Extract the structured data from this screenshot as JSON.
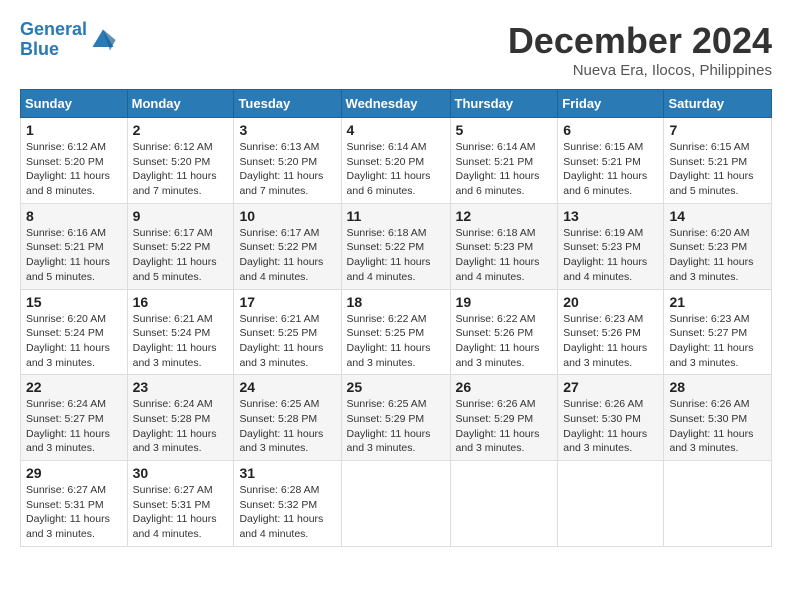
{
  "logo": {
    "line1": "General",
    "line2": "Blue"
  },
  "title": "December 2024",
  "location": "Nueva Era, Ilocos, Philippines",
  "weekdays": [
    "Sunday",
    "Monday",
    "Tuesday",
    "Wednesday",
    "Thursday",
    "Friday",
    "Saturday"
  ],
  "weeks": [
    [
      {
        "day": "1",
        "sunrise": "6:12 AM",
        "sunset": "5:20 PM",
        "daylight": "11 hours and 8 minutes."
      },
      {
        "day": "2",
        "sunrise": "6:12 AM",
        "sunset": "5:20 PM",
        "daylight": "11 hours and 7 minutes."
      },
      {
        "day": "3",
        "sunrise": "6:13 AM",
        "sunset": "5:20 PM",
        "daylight": "11 hours and 7 minutes."
      },
      {
        "day": "4",
        "sunrise": "6:14 AM",
        "sunset": "5:20 PM",
        "daylight": "11 hours and 6 minutes."
      },
      {
        "day": "5",
        "sunrise": "6:14 AM",
        "sunset": "5:21 PM",
        "daylight": "11 hours and 6 minutes."
      },
      {
        "day": "6",
        "sunrise": "6:15 AM",
        "sunset": "5:21 PM",
        "daylight": "11 hours and 6 minutes."
      },
      {
        "day": "7",
        "sunrise": "6:15 AM",
        "sunset": "5:21 PM",
        "daylight": "11 hours and 5 minutes."
      }
    ],
    [
      {
        "day": "8",
        "sunrise": "6:16 AM",
        "sunset": "5:21 PM",
        "daylight": "11 hours and 5 minutes."
      },
      {
        "day": "9",
        "sunrise": "6:17 AM",
        "sunset": "5:22 PM",
        "daylight": "11 hours and 5 minutes."
      },
      {
        "day": "10",
        "sunrise": "6:17 AM",
        "sunset": "5:22 PM",
        "daylight": "11 hours and 4 minutes."
      },
      {
        "day": "11",
        "sunrise": "6:18 AM",
        "sunset": "5:22 PM",
        "daylight": "11 hours and 4 minutes."
      },
      {
        "day": "12",
        "sunrise": "6:18 AM",
        "sunset": "5:23 PM",
        "daylight": "11 hours and 4 minutes."
      },
      {
        "day": "13",
        "sunrise": "6:19 AM",
        "sunset": "5:23 PM",
        "daylight": "11 hours and 4 minutes."
      },
      {
        "day": "14",
        "sunrise": "6:20 AM",
        "sunset": "5:23 PM",
        "daylight": "11 hours and 3 minutes."
      }
    ],
    [
      {
        "day": "15",
        "sunrise": "6:20 AM",
        "sunset": "5:24 PM",
        "daylight": "11 hours and 3 minutes."
      },
      {
        "day": "16",
        "sunrise": "6:21 AM",
        "sunset": "5:24 PM",
        "daylight": "11 hours and 3 minutes."
      },
      {
        "day": "17",
        "sunrise": "6:21 AM",
        "sunset": "5:25 PM",
        "daylight": "11 hours and 3 minutes."
      },
      {
        "day": "18",
        "sunrise": "6:22 AM",
        "sunset": "5:25 PM",
        "daylight": "11 hours and 3 minutes."
      },
      {
        "day": "19",
        "sunrise": "6:22 AM",
        "sunset": "5:26 PM",
        "daylight": "11 hours and 3 minutes."
      },
      {
        "day": "20",
        "sunrise": "6:23 AM",
        "sunset": "5:26 PM",
        "daylight": "11 hours and 3 minutes."
      },
      {
        "day": "21",
        "sunrise": "6:23 AM",
        "sunset": "5:27 PM",
        "daylight": "11 hours and 3 minutes."
      }
    ],
    [
      {
        "day": "22",
        "sunrise": "6:24 AM",
        "sunset": "5:27 PM",
        "daylight": "11 hours and 3 minutes."
      },
      {
        "day": "23",
        "sunrise": "6:24 AM",
        "sunset": "5:28 PM",
        "daylight": "11 hours and 3 minutes."
      },
      {
        "day": "24",
        "sunrise": "6:25 AM",
        "sunset": "5:28 PM",
        "daylight": "11 hours and 3 minutes."
      },
      {
        "day": "25",
        "sunrise": "6:25 AM",
        "sunset": "5:29 PM",
        "daylight": "11 hours and 3 minutes."
      },
      {
        "day": "26",
        "sunrise": "6:26 AM",
        "sunset": "5:29 PM",
        "daylight": "11 hours and 3 minutes."
      },
      {
        "day": "27",
        "sunrise": "6:26 AM",
        "sunset": "5:30 PM",
        "daylight": "11 hours and 3 minutes."
      },
      {
        "day": "28",
        "sunrise": "6:26 AM",
        "sunset": "5:30 PM",
        "daylight": "11 hours and 3 minutes."
      }
    ],
    [
      {
        "day": "29",
        "sunrise": "6:27 AM",
        "sunset": "5:31 PM",
        "daylight": "11 hours and 3 minutes."
      },
      {
        "day": "30",
        "sunrise": "6:27 AM",
        "sunset": "5:31 PM",
        "daylight": "11 hours and 4 minutes."
      },
      {
        "day": "31",
        "sunrise": "6:28 AM",
        "sunset": "5:32 PM",
        "daylight": "11 hours and 4 minutes."
      },
      null,
      null,
      null,
      null
    ]
  ],
  "labels": {
    "sunrise": "Sunrise: ",
    "sunset": "Sunset: ",
    "daylight": "Daylight hours"
  }
}
